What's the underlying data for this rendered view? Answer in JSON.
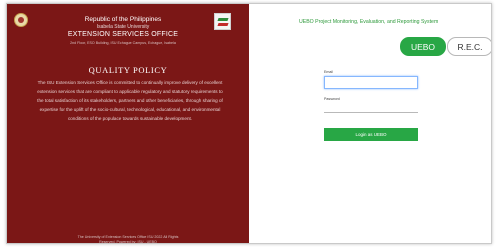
{
  "header": {
    "line1": "Republic of the Philippines",
    "line2": "Isabela State University",
    "office": "EXTENSION SERVICES OFFICE",
    "address": "2nd Floor, ESO Building, ISU Echague Campus, Echague, Isabela"
  },
  "quality_policy": {
    "title": "QUALITY POLICY",
    "body": "The ISU Extension Services Office is committed to continually improve delivery of excellent extension services that are compliant to applicable regulatory and statutory requirements to the total satisfaction of its stakeholders, partners and other beneficiaries, through sharing of expertise for the uplift of the socio-cultural, technological, educational, and environmental conditions of the populace towards sustainable development."
  },
  "footer": {
    "line1": "The University of Extension Services Office ISU 2022 All Rights",
    "line2": "Reserved. Powered by: ISU - UEBO"
  },
  "system": {
    "title": "UEBO Project Monitoring, Evaluation, and Reporting System"
  },
  "tabs": [
    {
      "label": "UEBO",
      "active": true
    },
    {
      "label": "R.E.C.",
      "active": false
    }
  ],
  "form": {
    "email_label": "Email",
    "email_value": "",
    "password_label": "Password",
    "password_value": "",
    "login_label": "Login as UEBO"
  },
  "colors": {
    "panel": "#7b1716",
    "accent": "#28a745"
  },
  "icons": [
    "university-seal-icon",
    "office-logo-icon"
  ]
}
